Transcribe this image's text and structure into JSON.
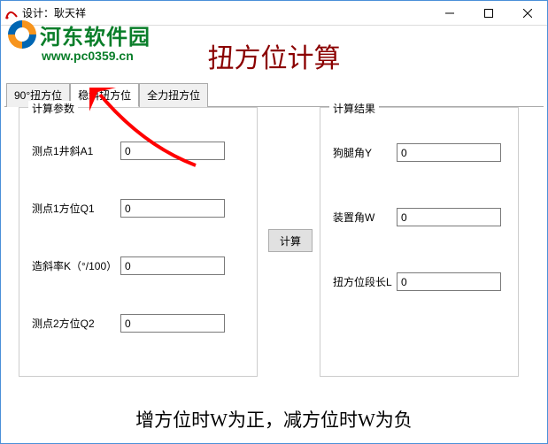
{
  "window": {
    "title": "设计：耿天祥"
  },
  "watermark": {
    "site_name": "河东软件园",
    "url": "www.pc0359.cn"
  },
  "page": {
    "title": "扭方位计算",
    "footer": "增方位时W为正，减方位时W为负"
  },
  "tabs": [
    {
      "label": "90°扭方位"
    },
    {
      "label": "稳斜扭方位"
    },
    {
      "label": "全力扭方位"
    }
  ],
  "params": {
    "legend": "计算参数",
    "fields": [
      {
        "label": "测点1井斜A1",
        "value": "0"
      },
      {
        "label": "测点1方位Q1",
        "value": "0"
      },
      {
        "label": "造斜率K（°/100）",
        "value": "0"
      },
      {
        "label": "测点2方位Q2",
        "value": "0"
      }
    ]
  },
  "results": {
    "legend": "计算结果",
    "fields": [
      {
        "label": "狗腿角Y",
        "value": "0"
      },
      {
        "label": "装置角W",
        "value": "0"
      },
      {
        "label": "扭方位段长L",
        "value": "0"
      }
    ]
  },
  "buttons": {
    "calculate": "计算"
  }
}
